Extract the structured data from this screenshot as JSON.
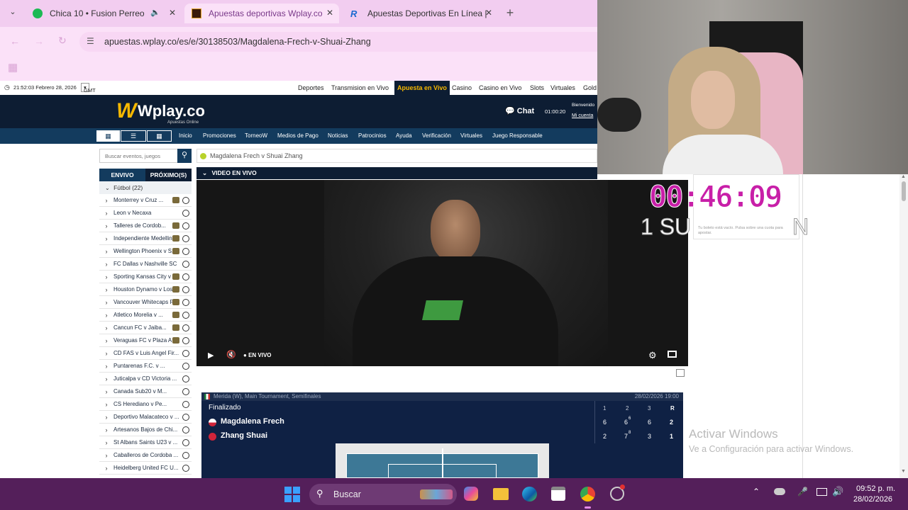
{
  "browser": {
    "tabs": [
      {
        "title": "Chica 10 • Fusion Perreo"
      },
      {
        "title": "Apuestas deportivas Wplay.co"
      },
      {
        "title": "Apuestas Deportivas En Línea |"
      }
    ],
    "url": "apuestas.wplay.co/es/e/30138503/Magdalena-Frech-v-Shuai-Zhang"
  },
  "site": {
    "datetime": "21:52:03 Febrero 28, 2026",
    "timezone": "GMT -5",
    "topnav": [
      "Deportes",
      "Transmision en Vivo",
      "Apuesta en Vivo",
      "Casino",
      "Casino en Vivo",
      "Slots",
      "Virtuales",
      "Gold"
    ],
    "logo": "Wplay.co",
    "logo_sub": "Apuestas Online",
    "chat": "Chat",
    "session_time": "01:00:20",
    "welcome": "Bienvenido",
    "my_account": "Mi cuenta",
    "menu": [
      "Inicio",
      "Promociones",
      "TorneoW",
      "Medios de Pago",
      "Noticias",
      "Patrocinios",
      "Ayuda",
      "Verificación",
      "Virtuales",
      "Juego Responsable"
    ],
    "search_placeholder": "Buscar eventos, juegos",
    "event_title": "Magdalena Frech v Shuai Zhang",
    "tab_live": "ENVIVO",
    "tab_next": "PRÓXIMO(S)",
    "sport": "Fútbol (22)",
    "matches": [
      "Monterrey v Cruz ...",
      "Leon v Necaxa",
      "Talleres de Cordob...",
      "Independiente Medellin ...",
      "Wellington Phoenix v S...",
      "FC Dallas v Nashville SC",
      "Sporting Kansas City v ...",
      "Houston Dynamo v Los ...",
      "Vancouver Whitecaps F...",
      "Atletico Morelia v ...",
      "Cancun FC v Jaiba...",
      "Veraguas FC v Plaza A...",
      "CD FAS v Luis Angel Fir...",
      "Puntarenas F.C. v ...",
      "Juticalpa v CD Victoria ...",
      "Canada Sub20 v M...",
      "CS Herediano v Pe...",
      "Deportivo Malacateco v ...",
      "Artesanos Bajos de Chi...",
      "St Albans Saints U23 v ...",
      "Caballeros de Cordoba ...",
      "Heidelberg United FC U..."
    ],
    "video_header": "VIDEO EN VIVO",
    "live_label": "EN VIVO",
    "betslip_text": "Tu boleto está vacío. Pulsa sobre una cuota para apostar.",
    "score": {
      "tournament": "Merida (W), Main Tournament, Semifinales",
      "date": "28/02/2026 19:00",
      "status": "Finalizado",
      "cols": [
        "1",
        "2",
        "3",
        "R"
      ],
      "players": [
        {
          "name": "Magdalena Frech",
          "sets": [
            "6",
            "6",
            "6",
            "2"
          ],
          "tb": [
            "",
            "6",
            "",
            ""
          ]
        },
        {
          "name": "Zhang Shuai",
          "sets": [
            "2",
            "7",
            "3",
            "1"
          ],
          "tb": [
            "",
            "8",
            "",
            ""
          ]
        }
      ]
    }
  },
  "overlay": {
    "timer": "00:46:09",
    "subs": "1 SU",
    "subs_tail": "N",
    "activate_title": "Activar Windows",
    "activate_sub": "Ve a Configuración para activar Windows."
  },
  "taskbar": {
    "search": "Buscar",
    "time": "09:52 p. m.",
    "date": "28/02/2026"
  },
  "colors": {
    "tabbar": "#f2cdf0",
    "header": "#0d1d33",
    "menubar": "#133b5e",
    "accent": "#f6b800",
    "timer": "#c81fa8",
    "taskbar": "#541f5a"
  }
}
